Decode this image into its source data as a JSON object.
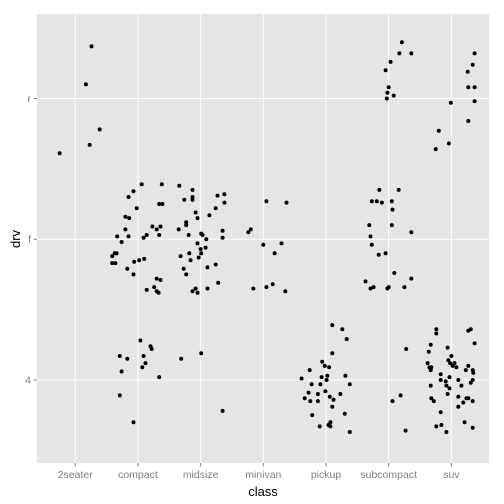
{
  "chart_data": {
    "type": "scatter",
    "title": "",
    "xlabel": "class",
    "ylabel": "drv",
    "x_categories": [
      "2seater",
      "compact",
      "midsize",
      "minivan",
      "pickup",
      "subcompact",
      "suv"
    ],
    "y_categories": [
      "4",
      "f",
      "r"
    ],
    "xlim": [
      0.39,
      7.6
    ],
    "ylim": [
      0.41,
      3.6
    ],
    "grid": true,
    "legend": "none",
    "colors": {
      "panel": "#e5e5e5",
      "grid": "#ffffff",
      "point": "#000000",
      "tick_text": "#7f7f7f",
      "tick_mark": "#7f7f7f"
    },
    "points": [
      [
        0.75,
        2.61
      ],
      [
        1.17,
        3.1
      ],
      [
        1.26,
        3.37
      ],
      [
        1.23,
        2.67
      ],
      [
        1.39,
        2.78
      ],
      [
        2.06,
        2.39
      ],
      [
        2.38,
        2.39
      ],
      [
        1.93,
        2.34
      ],
      [
        1.85,
        2.3
      ],
      [
        2.34,
        2.25
      ],
      [
        2.39,
        2.25
      ],
      [
        1.98,
        2.22
      ],
      [
        1.8,
        2.16
      ],
      [
        1.86,
        2.15
      ],
      [
        2.23,
        2.09
      ],
      [
        2.3,
        2.07
      ],
      [
        2.36,
        2.09
      ],
      [
        1.8,
        2.07
      ],
      [
        2.14,
        2.03
      ],
      [
        2.09,
        2.01
      ],
      [
        2.34,
        2.03
      ],
      [
        1.67,
        2.02
      ],
      [
        1.85,
        2.02
      ],
      [
        1.74,
        1.98
      ],
      [
        1.63,
        1.9
      ],
      [
        1.66,
        1.9
      ],
      [
        1.59,
        1.88
      ],
      [
        1.59,
        1.83
      ],
      [
        1.64,
        1.83
      ],
      [
        1.94,
        1.84
      ],
      [
        2.02,
        1.85
      ],
      [
        2.1,
        1.86
      ],
      [
        1.83,
        1.79
      ],
      [
        1.93,
        1.75
      ],
      [
        2.3,
        1.72
      ],
      [
        2.36,
        1.71
      ],
      [
        2.26,
        1.66
      ],
      [
        2.3,
        1.63
      ],
      [
        2.33,
        1.62
      ],
      [
        2.14,
        1.64
      ],
      [
        2.04,
        1.28
      ],
      [
        2.2,
        1.24
      ],
      [
        2.22,
        1.22
      ],
      [
        1.71,
        1.17
      ],
      [
        1.83,
        1.15
      ],
      [
        2.09,
        1.17
      ],
      [
        2.12,
        1.12
      ],
      [
        2.07,
        1.09
      ],
      [
        1.74,
        1.06
      ],
      [
        2.34,
        1.02
      ],
      [
        1.71,
        0.89
      ],
      [
        1.93,
        0.7
      ],
      [
        2.66,
        2.38
      ],
      [
        2.87,
        2.35
      ],
      [
        2.87,
        2.3
      ],
      [
        2.87,
        2.28
      ],
      [
        2.74,
        2.28
      ],
      [
        3.27,
        2.31
      ],
      [
        3.38,
        2.32
      ],
      [
        3.38,
        2.26
      ],
      [
        3.24,
        2.22
      ],
      [
        3.14,
        2.17
      ],
      [
        2.92,
        2.19
      ],
      [
        2.95,
        2.15
      ],
      [
        2.77,
        2.12
      ],
      [
        2.77,
        2.1
      ],
      [
        2.65,
        2.07
      ],
      [
        3.35,
        2.06
      ],
      [
        2.81,
        2.03
      ],
      [
        3.01,
        2.04
      ],
      [
        3.03,
        2.03
      ],
      [
        3.09,
        2.0
      ],
      [
        3.35,
        2.01
      ],
      [
        2.95,
        1.97
      ],
      [
        3.08,
        1.94
      ],
      [
        3.0,
        1.93
      ],
      [
        3.01,
        1.9
      ],
      [
        2.82,
        1.9
      ],
      [
        2.68,
        1.88
      ],
      [
        2.97,
        1.87
      ],
      [
        2.84,
        1.85
      ],
      [
        3.24,
        1.82
      ],
      [
        3.11,
        1.8
      ],
      [
        2.73,
        1.79
      ],
      [
        2.77,
        1.75
      ],
      [
        3.28,
        1.69
      ],
      [
        3.11,
        1.65
      ],
      [
        2.92,
        1.65
      ],
      [
        2.87,
        1.63
      ],
      [
        2.95,
        1.62
      ],
      [
        2.69,
        1.15
      ],
      [
        3.01,
        1.19
      ],
      [
        3.35,
        0.78
      ],
      [
        4.05,
        2.27
      ],
      [
        4.37,
        2.26
      ],
      [
        3.8,
        2.07
      ],
      [
        3.76,
        2.05
      ],
      [
        4.0,
        1.96
      ],
      [
        4.29,
        1.97
      ],
      [
        4.18,
        1.9
      ],
      [
        3.84,
        1.65
      ],
      [
        4.05,
        1.66
      ],
      [
        4.15,
        1.68
      ],
      [
        4.35,
        1.63
      ],
      [
        5.1,
        1.39
      ],
      [
        5.26,
        1.36
      ],
      [
        5.33,
        1.29
      ],
      [
        5.1,
        1.19
      ],
      [
        4.94,
        1.13
      ],
      [
        4.98,
        1.1
      ],
      [
        5.05,
        1.09
      ],
      [
        4.74,
        1.07
      ],
      [
        4.93,
        1.02
      ],
      [
        5.02,
        1.03
      ],
      [
        5.31,
        1.03
      ],
      [
        4.61,
        1.01
      ],
      [
        5.01,
        1.0
      ],
      [
        4.77,
        0.97
      ],
      [
        4.91,
        0.97
      ],
      [
        5.38,
        0.97
      ],
      [
        4.99,
        0.92
      ],
      [
        4.72,
        0.91
      ],
      [
        4.87,
        0.9
      ],
      [
        5.23,
        0.9
      ],
      [
        4.66,
        0.87
      ],
      [
        5.06,
        0.88
      ],
      [
        5.12,
        0.86
      ],
      [
        4.75,
        0.85
      ],
      [
        4.87,
        0.85
      ],
      [
        5.1,
        0.81
      ],
      [
        4.78,
        0.75
      ],
      [
        5.3,
        0.76
      ],
      [
        5.07,
        0.7
      ],
      [
        5.04,
        0.68
      ],
      [
        5.07,
        0.67
      ],
      [
        4.9,
        0.67
      ],
      [
        5.38,
        0.63
      ],
      [
        6.21,
        3.4
      ],
      [
        6.17,
        3.32
      ],
      [
        6.36,
        3.32
      ],
      [
        6.03,
        3.26
      ],
      [
        5.95,
        3.2
      ],
      [
        6.0,
        3.08
      ],
      [
        5.98,
        3.04
      ],
      [
        5.97,
        3.0
      ],
      [
        6.08,
        3.02
      ],
      [
        5.85,
        2.35
      ],
      [
        6.16,
        2.35
      ],
      [
        5.73,
        2.27
      ],
      [
        5.81,
        2.27
      ],
      [
        5.89,
        2.26
      ],
      [
        6.05,
        2.27
      ],
      [
        6.06,
        2.21
      ],
      [
        5.69,
        2.1
      ],
      [
        6.05,
        2.1
      ],
      [
        6.36,
        2.05
      ],
      [
        5.71,
        2.02
      ],
      [
        5.73,
        1.96
      ],
      [
        5.84,
        1.89
      ],
      [
        5.95,
        1.9
      ],
      [
        6.09,
        1.76
      ],
      [
        5.63,
        1.7
      ],
      [
        6.36,
        1.72
      ],
      [
        5.71,
        1.65
      ],
      [
        5.76,
        1.66
      ],
      [
        5.98,
        1.65
      ],
      [
        6.0,
        1.66
      ],
      [
        6.25,
        1.66
      ],
      [
        6.28,
        1.22
      ],
      [
        6.19,
        0.89
      ],
      [
        6.06,
        0.85
      ],
      [
        6.27,
        0.64
      ],
      [
        7.37,
        3.32
      ],
      [
        7.34,
        3.24
      ],
      [
        7.26,
        3.19
      ],
      [
        7.27,
        3.08
      ],
      [
        7.37,
        3.08
      ],
      [
        7.37,
        2.98
      ],
      [
        6.99,
        2.97
      ],
      [
        7.27,
        2.84
      ],
      [
        6.8,
        2.77
      ],
      [
        6.96,
        2.68
      ],
      [
        6.75,
        2.64
      ],
      [
        6.76,
        1.36
      ],
      [
        6.76,
        1.33
      ],
      [
        7.27,
        1.35
      ],
      [
        7.31,
        1.36
      ],
      [
        6.67,
        1.25
      ],
      [
        7.37,
        1.26
      ],
      [
        6.94,
        1.23
      ],
      [
        6.64,
        1.2
      ],
      [
        7.0,
        1.17
      ],
      [
        6.95,
        1.14
      ],
      [
        6.98,
        1.12
      ],
      [
        7.05,
        1.12
      ],
      [
        7.02,
        1.1
      ],
      [
        7.08,
        1.09
      ],
      [
        6.62,
        1.12
      ],
      [
        6.65,
        1.09
      ],
      [
        6.68,
        1.09
      ],
      [
        6.67,
        1.07
      ],
      [
        7.27,
        1.1
      ],
      [
        7.23,
        1.07
      ],
      [
        7.34,
        1.07
      ],
      [
        7.35,
        1.05
      ],
      [
        6.83,
        1.04
      ],
      [
        6.97,
        1.02
      ],
      [
        6.83,
        1.0
      ],
      [
        6.91,
        0.99
      ],
      [
        7.11,
        1.0
      ],
      [
        7.34,
        1.0
      ],
      [
        7.31,
        0.98
      ],
      [
        6.67,
        0.96
      ],
      [
        6.92,
        0.96
      ],
      [
        7.16,
        0.96
      ],
      [
        6.97,
        0.94
      ],
      [
        6.94,
        0.9
      ],
      [
        7.11,
        0.88
      ],
      [
        6.68,
        0.87
      ],
      [
        6.72,
        0.85
      ],
      [
        7.24,
        0.87
      ],
      [
        7.27,
        0.87
      ],
      [
        7.19,
        0.84
      ],
      [
        7.34,
        0.85
      ],
      [
        7.11,
        0.81
      ],
      [
        6.83,
        0.77
      ],
      [
        7.21,
        0.7
      ],
      [
        6.84,
        0.68
      ],
      [
        6.76,
        0.67
      ],
      [
        7.34,
        0.66
      ],
      [
        6.92,
        0.63
      ]
    ]
  }
}
